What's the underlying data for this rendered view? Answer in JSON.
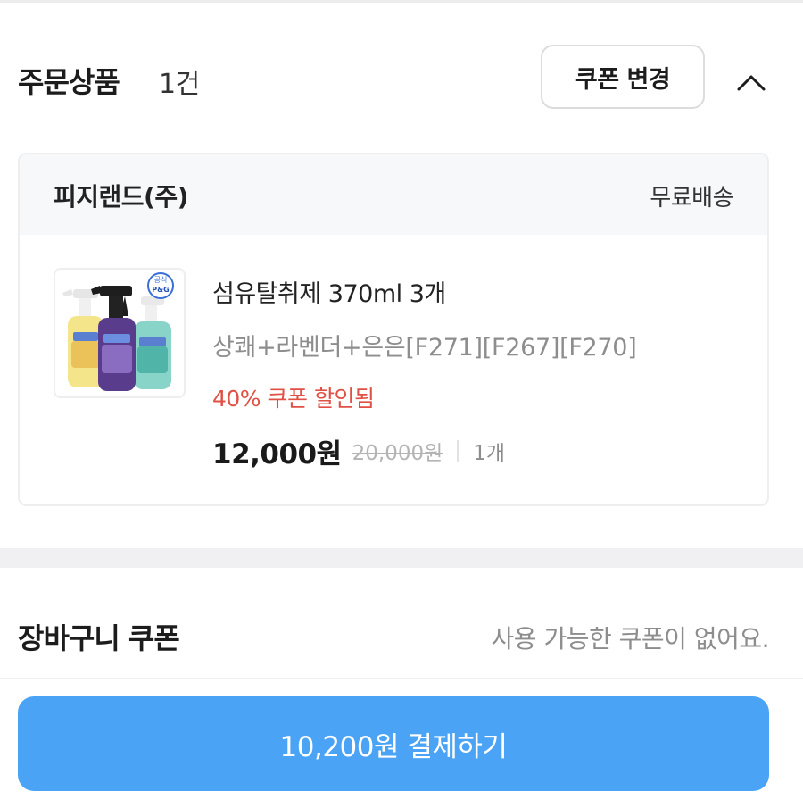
{
  "order_section": {
    "title": "주문상품",
    "count": "1건",
    "coupon_change_label": "쿠폰 변경"
  },
  "seller": {
    "name": "피지랜드(주)",
    "shipping": "무료배송"
  },
  "product": {
    "name": "섬유탈취제 370ml 3개",
    "option": "상쾌+라벤더+은은[F271][F267][F270]",
    "discount": "40% 쿠폰 할인됨",
    "price": "12,000원",
    "original_price": "20,000원",
    "quantity": "1개",
    "thumb_badge": "공식",
    "thumb_brand": "P&G"
  },
  "cart_coupon": {
    "title": "장바구니 쿠폰",
    "status": "사용 가능한 쿠폰이 없어요."
  },
  "payment": {
    "button_label": "10,200원 결제하기"
  },
  "colors": {
    "accent": "#4aa3f5",
    "discount": "#e05045",
    "muted": "#8d8d8d"
  }
}
